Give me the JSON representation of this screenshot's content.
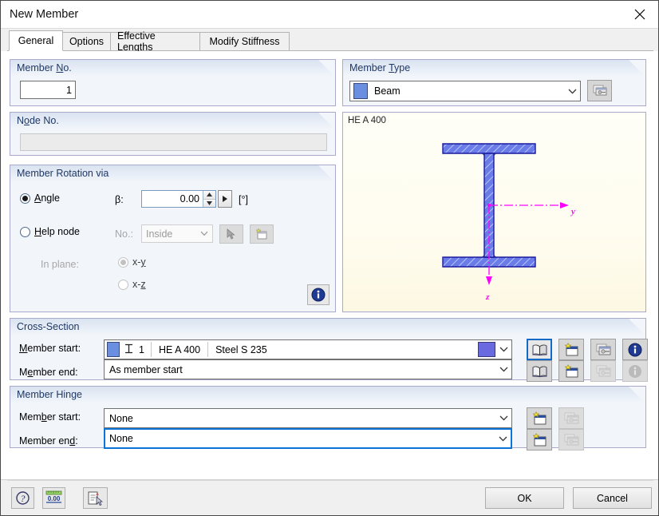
{
  "window": {
    "title": "New Member",
    "close_icon": "close-icon"
  },
  "tabs": [
    {
      "label": "General",
      "active": true
    },
    {
      "label": "Options",
      "active": false
    },
    {
      "label": "Effective Lengths",
      "active": false
    },
    {
      "label": "Modify Stiffness",
      "active": false
    }
  ],
  "member_no": {
    "title_pre": "Member ",
    "title_key": "N",
    "title_post": "o.",
    "value": "1"
  },
  "node_no": {
    "title_pre": "N",
    "title_key": "o",
    "title_post": "de No.",
    "value": ""
  },
  "member_rotation": {
    "title": "Member Rotation via",
    "angle": {
      "label_pre": "",
      "label_key": "A",
      "label_post": "ngle",
      "selected": true,
      "symbol": "β:",
      "value": "0.00",
      "unit": "[°]",
      "more_arrow": "▶"
    },
    "help_node": {
      "label_pre": "",
      "label_key": "H",
      "label_post": "elp node",
      "selected": false,
      "no_label": "No.:",
      "combo_value": "Inside",
      "pick_icon": "pick-node-icon",
      "new_icon": "new-node-icon"
    },
    "in_plane": {
      "label": "In plane:",
      "options": [
        {
          "pre": "x-",
          "key": "y",
          "post": "",
          "selected": true
        },
        {
          "pre": "x-",
          "key": "z",
          "post": "",
          "selected": false
        }
      ]
    },
    "info_icon": "info-icon"
  },
  "member_type": {
    "title_pre": "Member ",
    "title_key": "T",
    "title_post": "ype",
    "value": "Beam",
    "swatch_color": "#6a8ee0",
    "edit_icon": "edit-type-icon"
  },
  "cross_section_preview": {
    "label": "HE A 400",
    "fill_color": "#6a7ce8",
    "outline_color": "#1a1aa0",
    "axis_color": "#ff00ff",
    "axis_y_label": "y",
    "axis_z_label": "z"
  },
  "cross_section": {
    "title": "Cross-Section",
    "start": {
      "label_pre": "",
      "label_key": "M",
      "label_post": "ember start:",
      "swatch_color": "#6a8ee0",
      "section_icon": "i-section-icon",
      "number": "1",
      "name": "HE A 400",
      "material": "Steel S 235",
      "end_swatch_color": "#6a6ae0"
    },
    "end": {
      "label_pre": "M",
      "label_key": "e",
      "label_post": "mber end:",
      "value": "As member start"
    },
    "buttons_start": [
      {
        "name": "library-icon",
        "selected": true,
        "disabled": false
      },
      {
        "name": "new-section-icon",
        "selected": false,
        "disabled": false
      },
      {
        "name": "edit-section-icon",
        "selected": false,
        "disabled": false
      },
      {
        "name": "info-icon",
        "selected": false,
        "disabled": false
      }
    ],
    "buttons_end": [
      {
        "name": "library-icon",
        "selected": false,
        "disabled": false
      },
      {
        "name": "new-section-icon",
        "selected": false,
        "disabled": false
      },
      {
        "name": "edit-section-icon",
        "selected": false,
        "disabled": true
      },
      {
        "name": "info-icon",
        "selected": false,
        "disabled": true
      }
    ]
  },
  "member_hinge": {
    "title": "Member Hinge",
    "start": {
      "label_pre": "Mem",
      "label_key": "b",
      "label_post": "er start:",
      "value": "None"
    },
    "end": {
      "label_pre": "Member en",
      "label_key": "d",
      "label_post": ":",
      "value": "None",
      "focused": true
    },
    "buttons_start": [
      {
        "name": "new-hinge-icon",
        "disabled": false
      },
      {
        "name": "edit-hinge-icon",
        "disabled": true
      }
    ],
    "buttons_end": [
      {
        "name": "new-hinge-icon",
        "disabled": false
      },
      {
        "name": "edit-hinge-icon",
        "disabled": true
      }
    ]
  },
  "footer": {
    "tools": [
      {
        "name": "help-icon"
      },
      {
        "name": "units-icon"
      },
      {
        "name": "default-settings-icon"
      }
    ],
    "ok_label": "OK",
    "cancel_label": "Cancel"
  }
}
